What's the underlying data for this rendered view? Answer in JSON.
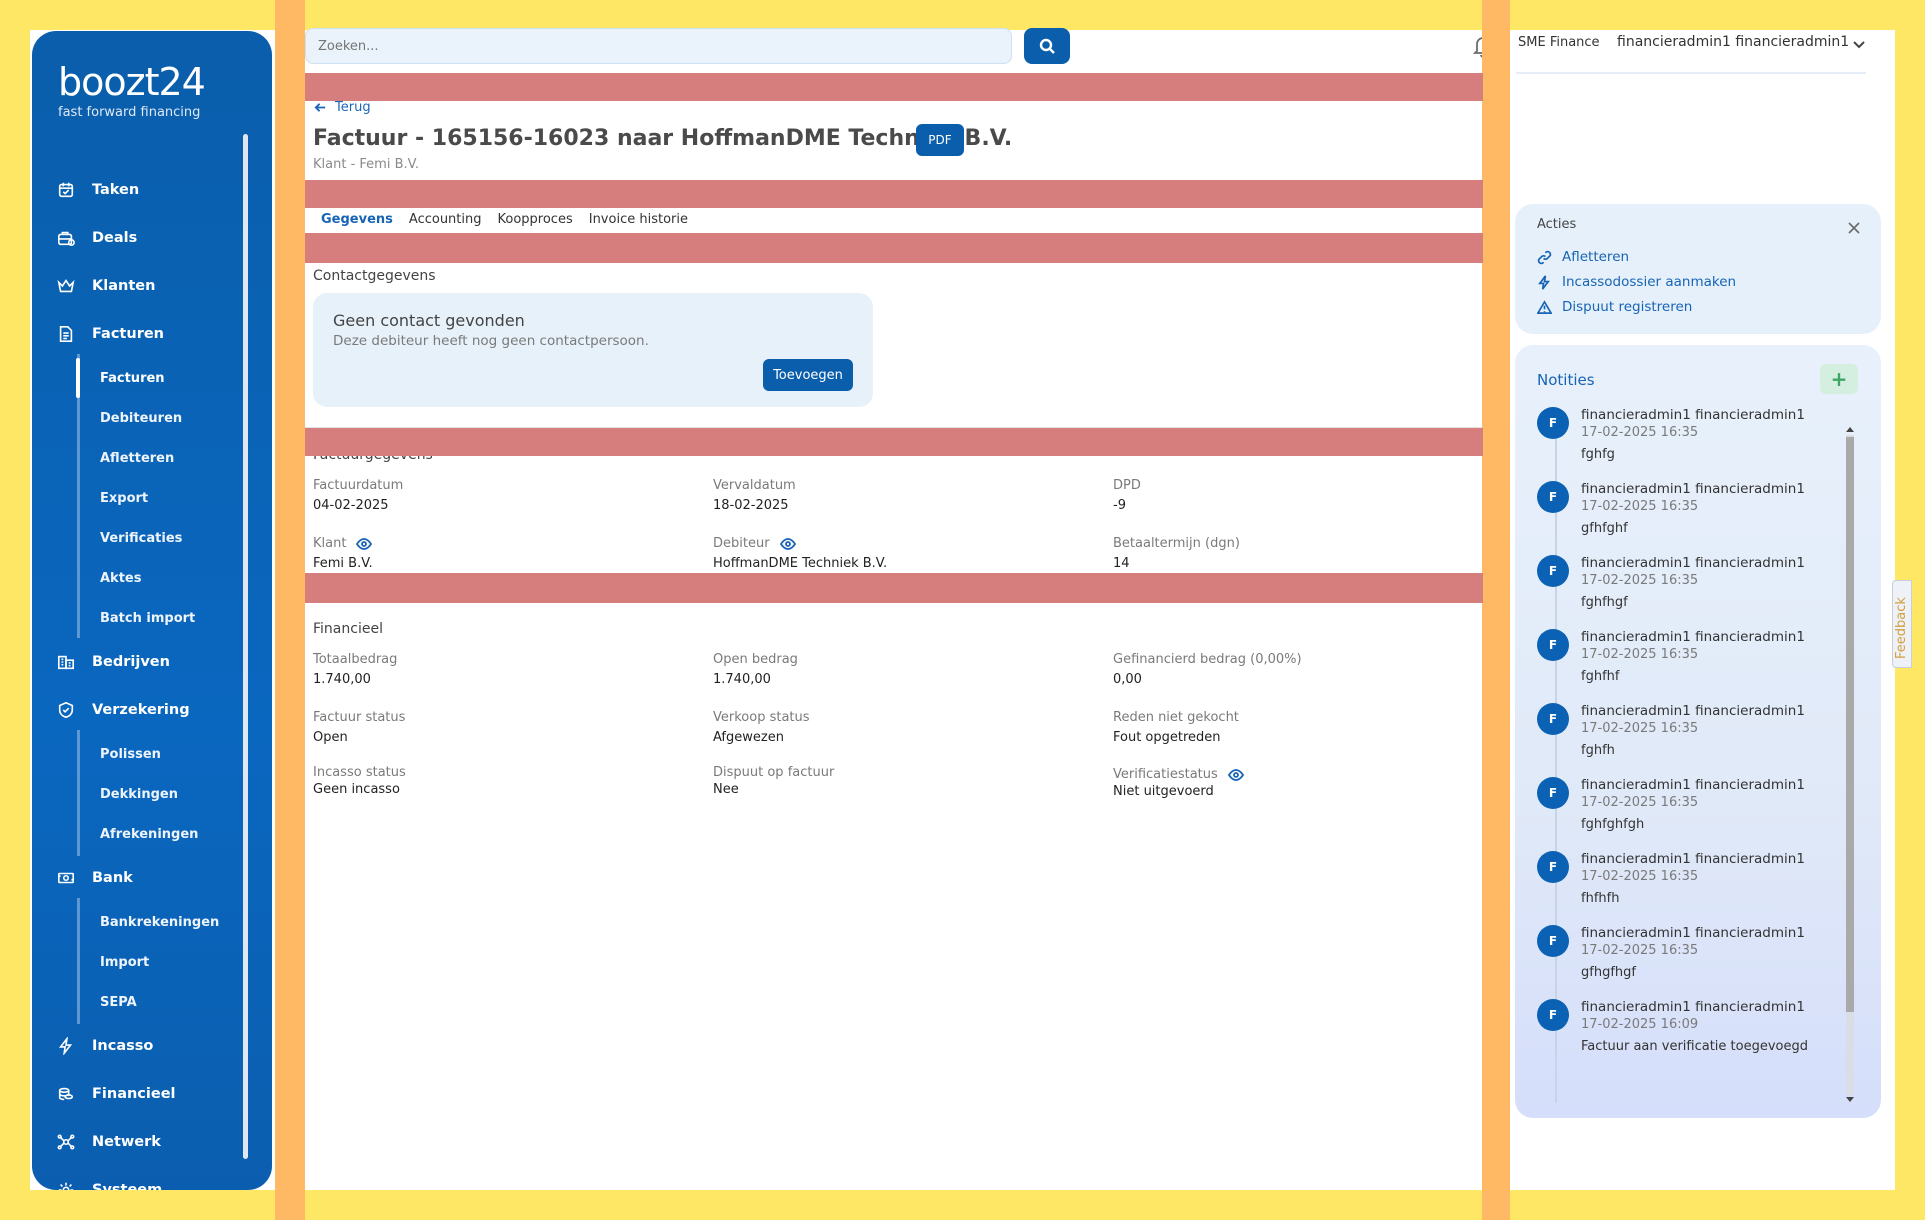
{
  "brand": {
    "name": "boozt24",
    "tagline": "fast forward financing"
  },
  "sidebar": {
    "items": [
      {
        "label": "Taken",
        "icon": "calendar-check-icon"
      },
      {
        "label": "Deals",
        "icon": "briefcase-icon"
      },
      {
        "label": "Klanten",
        "icon": "crown-icon"
      },
      {
        "label": "Facturen",
        "icon": "document-icon"
      },
      {
        "label": "Bedrijven",
        "icon": "building-icon"
      },
      {
        "label": "Verzekering",
        "icon": "shield-check-icon"
      },
      {
        "label": "Bank",
        "icon": "cash-icon"
      },
      {
        "label": "Incasso",
        "icon": "lightning-icon"
      },
      {
        "label": "Financieel",
        "icon": "coins-icon"
      },
      {
        "label": "Netwerk",
        "icon": "network-icon"
      },
      {
        "label": "Systeem",
        "icon": "gear-icon"
      }
    ],
    "facturen_sub": [
      "Facturen",
      "Debiteuren",
      "Afletteren",
      "Export",
      "Verificaties",
      "Aktes",
      "Batch import"
    ],
    "verzekering_sub": [
      "Polissen",
      "Dekkingen",
      "Afrekeningen"
    ],
    "bank_sub": [
      "Bankrekeningen",
      "Import",
      "SEPA"
    ]
  },
  "topbar": {
    "search_placeholder": "Zoeken...",
    "org": "SME Finance",
    "user": "financieradmin1 financieradmin1"
  },
  "page": {
    "back_label": "Terug",
    "title": "Factuur - 165156-16023 naar HoffmanDME Techniek B.V.",
    "pdf_label": "PDF",
    "subtitle": "Klant - Femi B.V.",
    "tabs": [
      "Gegevens",
      "Accounting",
      "Koopproces",
      "Invoice historie"
    ],
    "active_tab": "Gegevens"
  },
  "contact": {
    "section": "Contactgegevens",
    "title": "Geen contact gevonden",
    "text": "Deze debiteur heeft nog geen contactpersoon.",
    "button": "Toevoegen"
  },
  "factuur": {
    "section": "Factuurgegevens",
    "fields": [
      {
        "label": "Factuurdatum",
        "value": "04-02-2025"
      },
      {
        "label": "Vervaldatum",
        "value": "18-02-2025"
      },
      {
        "label": "DPD",
        "value": "-9"
      },
      {
        "label": "Klant",
        "value": "Femi B.V."
      },
      {
        "label": "Debiteur",
        "value": "HoffmanDME Techniek B.V."
      },
      {
        "label": "Betaaltermijn (dgn)",
        "value": "14"
      }
    ]
  },
  "financieel": {
    "section": "Financieel",
    "fields": [
      {
        "label": "Totaalbedrag",
        "value": "1.740,00"
      },
      {
        "label": "Open bedrag",
        "value": "1.740,00"
      },
      {
        "label": "Gefinancierd bedrag (0,00%)",
        "value": "0,00"
      },
      {
        "label": "Factuur status",
        "value": "Open"
      },
      {
        "label": "Verkoop status",
        "value": "Afgewezen"
      },
      {
        "label": "Reden niet gekocht",
        "value": "Fout opgetreden"
      },
      {
        "label": "Incasso status",
        "value": "Geen incasso"
      },
      {
        "label": "Dispuut op factuur",
        "value": "Nee"
      },
      {
        "label": "Verificatiestatus",
        "value": "Niet uitgevoerd"
      }
    ]
  },
  "acties": {
    "title": "Acties",
    "items": [
      "Afletteren",
      "Incassodossier aanmaken",
      "Dispuut registreren"
    ]
  },
  "notities": {
    "title": "Notities",
    "add_label": "+",
    "items": [
      {
        "initial": "F",
        "author": "financieradmin1 financieradmin1",
        "date": "17-02-2025 16:35",
        "text": "fghfg"
      },
      {
        "initial": "F",
        "author": "financieradmin1 financieradmin1",
        "date": "17-02-2025 16:35",
        "text": "gfhfghf"
      },
      {
        "initial": "F",
        "author": "financieradmin1 financieradmin1",
        "date": "17-02-2025 16:35",
        "text": "fghfhgf"
      },
      {
        "initial": "F",
        "author": "financieradmin1 financieradmin1",
        "date": "17-02-2025 16:35",
        "text": "fghfhf"
      },
      {
        "initial": "F",
        "author": "financieradmin1 financieradmin1",
        "date": "17-02-2025 16:35",
        "text": "fghfh"
      },
      {
        "initial": "F",
        "author": "financieradmin1 financieradmin1",
        "date": "17-02-2025 16:35",
        "text": "fghfghfgh"
      },
      {
        "initial": "F",
        "author": "financieradmin1 financieradmin1",
        "date": "17-02-2025 16:35",
        "text": "fhfhfh"
      },
      {
        "initial": "F",
        "author": "financieradmin1 financieradmin1",
        "date": "17-02-2025 16:35",
        "text": "gfhgfhgf"
      },
      {
        "initial": "F",
        "author": "financieradmin1 financieradmin1",
        "date": "17-02-2025 16:09",
        "text": "Factuur aan verificatie toegevoegd"
      }
    ]
  },
  "feedback_label": "Feedback",
  "colors": {
    "primary": "#0b5eab",
    "link": "#1764b5",
    "overlay_orange": "#ffb964",
    "overlay_red": "#d67e7e",
    "frame_yellow": "#ffe766"
  }
}
